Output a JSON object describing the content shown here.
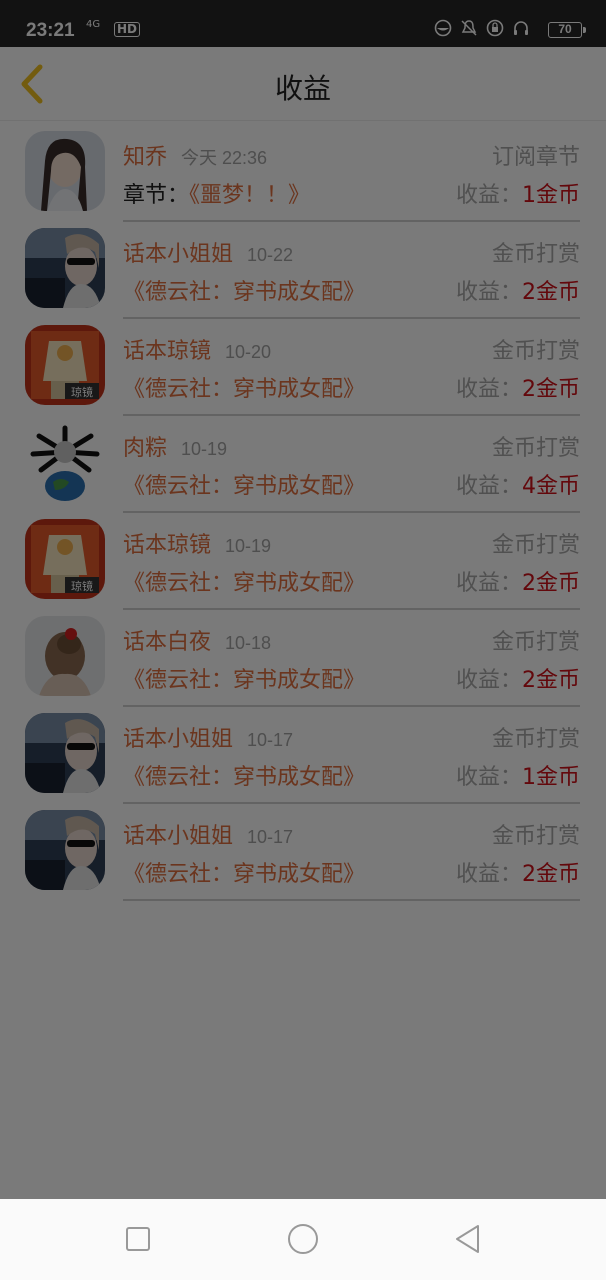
{
  "status_bar": {
    "time": "23:21",
    "network": "4G",
    "hd": "HD",
    "battery": "70"
  },
  "header": {
    "title": "收益"
  },
  "records": [
    {
      "name": "知乔",
      "date": "今天 22:36",
      "type": "订阅章节",
      "prefix": "章节：",
      "work": "《噩梦！！》",
      "income_label": "收益：",
      "amount": "1金币",
      "avatar": "portrait-woman"
    },
    {
      "name": "话本小姐姐",
      "date": "10-22",
      "type": "金币打赏",
      "prefix": "",
      "work": "《德云社：穿书成女配》",
      "income_label": "收益：",
      "amount": "2金币",
      "avatar": "car-selfie"
    },
    {
      "name": "话本琼镜",
      "date": "10-20",
      "type": "金币打赏",
      "prefix": "",
      "work": "《德云社：穿书成女配》",
      "income_label": "收益：",
      "amount": "2金币",
      "avatar": "qiongjing"
    },
    {
      "name": "肉粽",
      "date": "10-19",
      "type": "金币打赏",
      "prefix": "",
      "work": "《德云社：穿书成女配》",
      "income_label": "收益：",
      "amount": "4金币",
      "avatar": "earth-meme"
    },
    {
      "name": "话本琼镜",
      "date": "10-19",
      "type": "金币打赏",
      "prefix": "",
      "work": "《德云社：穿书成女配》",
      "income_label": "收益：",
      "amount": "2金币",
      "avatar": "qiongjing"
    },
    {
      "name": "话本白夜",
      "date": "10-18",
      "type": "金币打赏",
      "prefix": "",
      "work": "《德云社：穿书成女配》",
      "income_label": "收益：",
      "amount": "2金币",
      "avatar": "hair-bun"
    },
    {
      "name": "话本小姐姐",
      "date": "10-17",
      "type": "金币打赏",
      "prefix": "",
      "work": "《德云社：穿书成女配》",
      "income_label": "收益：",
      "amount": "1金币",
      "avatar": "car-selfie"
    },
    {
      "name": "话本小姐姐",
      "date": "10-17",
      "type": "金币打赏",
      "prefix": "",
      "work": "《德云社：穿书成女配》",
      "income_label": "收益：",
      "amount": "2金币",
      "avatar": "car-selfie"
    }
  ],
  "colors": {
    "accent": "#e0703f",
    "amount": "#d0121b",
    "back_arrow": "#f0c020"
  }
}
